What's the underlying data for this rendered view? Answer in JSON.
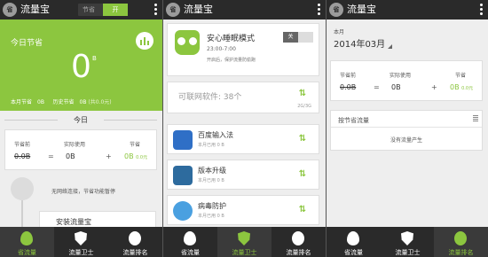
{
  "app": {
    "logo": "省",
    "title": "流量宝"
  },
  "panel1": {
    "toggle": {
      "off": "节省",
      "on": "开"
    },
    "today_title": "今日节省",
    "today_value": "0",
    "today_unit": "B",
    "month_saved_label": "本月节省",
    "month_saved_value": "0B",
    "history_label": "历史节省",
    "history_value": "0B",
    "history_sub": "(共0.0元)",
    "section": "今日",
    "before_label": "节省前",
    "before_value": "0.0B",
    "actual_label": "实际使用",
    "actual_value": "0B",
    "saved_label": "节省",
    "saved_value": "0B",
    "saved_money": "0.0元",
    "op_eq": "=",
    "op_plus": "+",
    "no_network": "无网络连接，节省功能暂停",
    "card_bottom": "安装流量宝"
  },
  "panel2": {
    "mode_title": "安心睡眠模式",
    "mode_time": "23:00-7:00",
    "mode_desc": "开启后，保护流量防偷跑",
    "mode_switch": "关",
    "connected_label": "可联网软件: 38个",
    "network_type": "2G/3G",
    "apps": [
      {
        "name": "百度输入法",
        "usage": "本月已用 0 B"
      },
      {
        "name": "版本升级",
        "usage": "本月已用 0 B"
      },
      {
        "name": "病毒防护",
        "usage": "本月已用 0 B"
      }
    ]
  },
  "panel3": {
    "month_label": "本月",
    "month_value": "2014年03月",
    "before_label": "节省前",
    "before_value": "0.0B",
    "actual_label": "实际使用",
    "actual_value": "0B",
    "saved_label": "节省",
    "saved_value": "0B",
    "saved_money": "0.0元",
    "op_eq": "=",
    "op_plus": "+",
    "list_header": "按节省流量",
    "empty": "没有流量产生"
  },
  "nav": [
    {
      "label": "省流量",
      "icon": "drop-icon"
    },
    {
      "label": "流量卫士",
      "icon": "shield-icon"
    },
    {
      "label": "流量排名",
      "icon": "medal-icon"
    }
  ],
  "colors": {
    "accent": "#8cc63f",
    "bar": "#2a2a2a"
  }
}
